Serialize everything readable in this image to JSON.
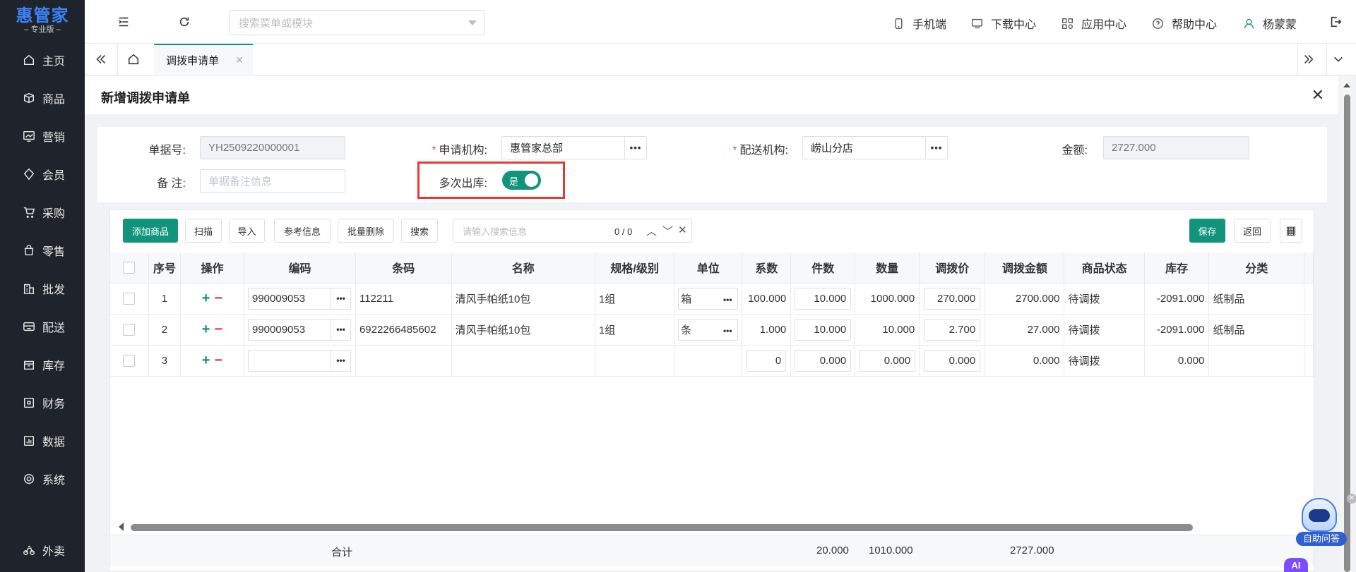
{
  "brand": {
    "name": "惠管家",
    "edition": "专业版"
  },
  "sidebar": {
    "items": [
      {
        "label": "主页",
        "icon": "home-icon"
      },
      {
        "label": "商品",
        "icon": "box-icon"
      },
      {
        "label": "营销",
        "icon": "chart-icon"
      },
      {
        "label": "会员",
        "icon": "diamond-icon"
      },
      {
        "label": "采购",
        "icon": "cart-icon"
      },
      {
        "label": "零售",
        "icon": "bag-icon"
      },
      {
        "label": "批发",
        "icon": "building-icon"
      },
      {
        "label": "配送",
        "icon": "truck-icon"
      },
      {
        "label": "库存",
        "icon": "inventory-icon"
      },
      {
        "label": "财务",
        "icon": "finance-icon"
      },
      {
        "label": "数据",
        "icon": "data-icon"
      },
      {
        "label": "系统",
        "icon": "settings-icon"
      }
    ],
    "bottom_item": {
      "label": "外卖",
      "icon": "delivery-icon"
    }
  },
  "header": {
    "search_placeholder": "搜索菜单或模块",
    "links": {
      "mobile": "手机端",
      "download": "下载中心",
      "apps": "应用中心",
      "help": "帮助中心",
      "user": "杨蒙蒙"
    }
  },
  "tabs": {
    "active": "调拨申请单"
  },
  "panel": {
    "title": "新增调拨申请单",
    "form": {
      "doc_no_label": "单据号:",
      "doc_no_value": "YH2509220000001",
      "apply_org_label": "申请机构:",
      "apply_org_value": "惠管家总部",
      "dist_org_label": "配送机构:",
      "dist_org_value": "崂山分店",
      "amount_label": "金额:",
      "amount_value": "2727.000",
      "remark_label": "备 注:",
      "remark_placeholder": "单据备注信息",
      "multi_out_label": "多次出库:",
      "multi_out_value": "是",
      "multi_out_enabled": true
    }
  },
  "toolbar": {
    "add": "添加商品",
    "scan": "扫描",
    "import": "导入",
    "reference": "参考信息",
    "batch_delete": "批量删除",
    "search": "搜索",
    "search_placeholder": "请输入搜索信息",
    "match_count": "0 / 0",
    "save": "保存",
    "back": "返回"
  },
  "table": {
    "columns": [
      "序号",
      "操作",
      "编码",
      "条码",
      "名称",
      "规格/级别",
      "单位",
      "系数",
      "件数",
      "数量",
      "调拨价",
      "调拨金额",
      "商品状态",
      "库存",
      "分类"
    ],
    "rows": [
      {
        "no": "1",
        "code": "990009053",
        "barcode": "112211",
        "name": "清风手帕纸10包",
        "spec": "1组",
        "unit": "箱",
        "factor": "100.000",
        "pieces": "10.000",
        "qty": "1000.000",
        "price": "270.000",
        "amount": "2700.000",
        "status": "待调拨",
        "stock": "-2091.000",
        "category": "纸制品"
      },
      {
        "no": "2",
        "code": "990009053",
        "barcode": "6922266485602",
        "name": "清风手帕纸10包",
        "spec": "1组",
        "unit": "条",
        "factor": "1.000",
        "pieces": "10.000",
        "qty": "10.000",
        "price": "2.700",
        "amount": "27.000",
        "status": "待调拨",
        "stock": "-2091.000",
        "category": "纸制品"
      },
      {
        "no": "3",
        "code": "",
        "barcode": "",
        "name": "",
        "spec": "",
        "unit": "",
        "factor": "0",
        "pieces": "0.000",
        "qty": "0.000",
        "price": "0.000",
        "amount": "0.000",
        "status": "待调拨",
        "stock": "0.000",
        "category": ""
      }
    ],
    "summary": {
      "label": "合计",
      "pieces": "20.000",
      "qty": "1010.000",
      "amount": "2727.000"
    }
  },
  "assistant": {
    "label": "自助问答",
    "ai": "AI"
  },
  "colors": {
    "primary": "#11937c",
    "sidebar": "#1f232b",
    "highlight": "#e53935",
    "danger": "#e53935"
  }
}
